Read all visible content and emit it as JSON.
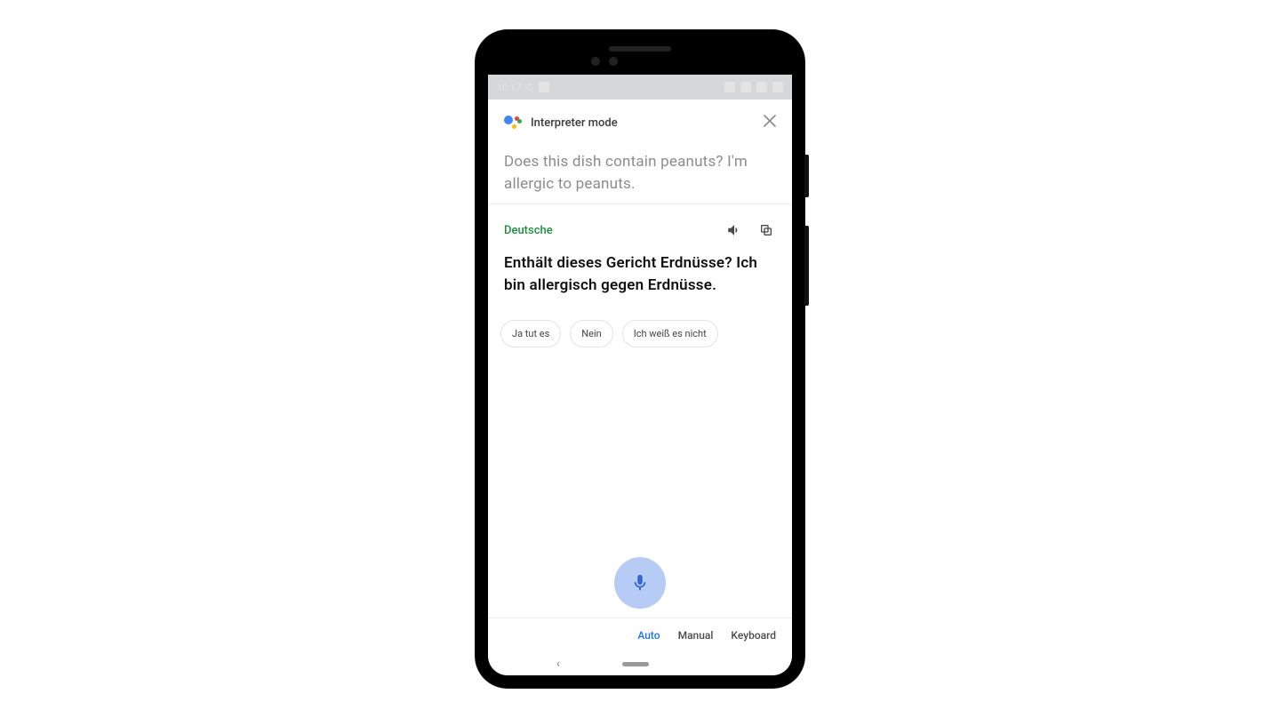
{
  "status": {
    "time": "10:17",
    "carrier_icon": "G"
  },
  "header": {
    "mode_title": "Interpreter mode"
  },
  "source": {
    "text": "Does this dish contain peanuts? I'm allergic to peanuts."
  },
  "translation": {
    "lang_label": "Deutsche",
    "text": "Enthält dieses Gericht Erdnüsse? Ich bin allergisch gegen Erdnüsse."
  },
  "suggestions": [
    "Ja tut es",
    "Nein",
    "Ich weiß es nicht"
  ],
  "tabs": {
    "auto": "Auto",
    "manual": "Manual",
    "keyboard": "Keyboard",
    "active": "auto"
  }
}
